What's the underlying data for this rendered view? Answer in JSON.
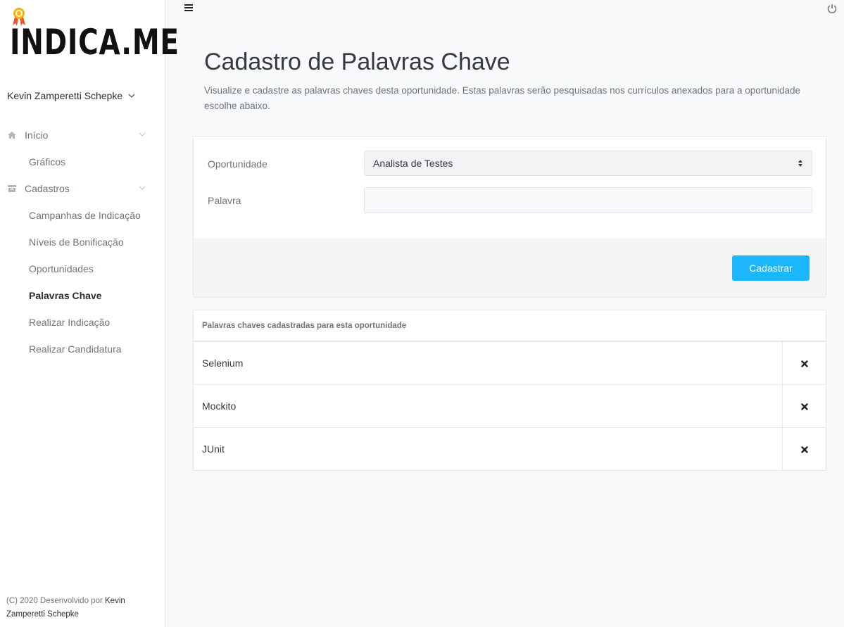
{
  "brand": {
    "logo_text": "INDICA.ME"
  },
  "user": {
    "name": "Kevin Zamperetti Schepke"
  },
  "sidebar": {
    "items": [
      {
        "label": "Início",
        "icon": "home-icon"
      },
      {
        "label": "Gráficos"
      },
      {
        "label": "Cadastros",
        "icon": "archive-icon"
      },
      {
        "label": "Campanhas de Indicação"
      },
      {
        "label": "Níveis de Bonificação"
      },
      {
        "label": "Oportunidades"
      },
      {
        "label": "Palavras Chave",
        "active": true
      },
      {
        "label": "Realizar Indicação"
      },
      {
        "label": "Realizar Candidatura"
      }
    ]
  },
  "footer": {
    "prefix": "(C) 2020 Desenvolvido por",
    "author": "Kevin Zamperetti Schepke"
  },
  "page": {
    "title": "Cadastro de Palavras Chave",
    "description": "Visualize e cadastre as palavras chaves desta oportunidade. Estas palavras serão pesquisadas nos currículos anexados para a oportunidade escolhe abaixo."
  },
  "form": {
    "opportunity_label": "Oportunidade",
    "opportunity_value": "Analista de Testes",
    "word_label": "Palavra",
    "word_value": "",
    "submit_label": "Cadastrar"
  },
  "table": {
    "header": "Palavras chaves cadastradas para esta oportunidade",
    "rows": [
      {
        "word": "Selenium"
      },
      {
        "word": "Mockito"
      },
      {
        "word": "JUnit"
      }
    ]
  },
  "colors": {
    "accent": "#1cb6ff"
  }
}
